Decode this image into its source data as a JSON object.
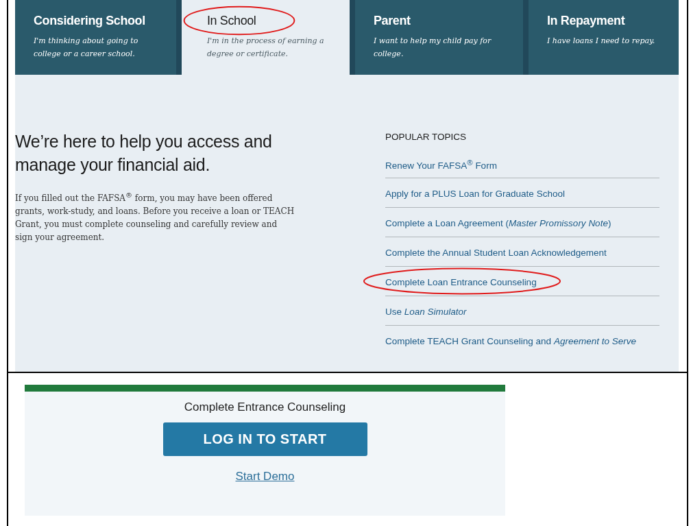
{
  "tabs": [
    {
      "title": "Considering School",
      "subtitle": "I'm thinking about going to college or a career school.",
      "selected": false,
      "circled": false
    },
    {
      "title": "In School",
      "subtitle": "I'm in the process of earning a degree or certificate.",
      "selected": true,
      "circled": true
    },
    {
      "title": "Parent",
      "subtitle": "I want to help my child pay for college.",
      "selected": false,
      "circled": false
    },
    {
      "title": "In Repayment",
      "subtitle": "I have loans I need to repay.",
      "selected": false,
      "circled": false
    }
  ],
  "hero": {
    "heading": "We’re here to help you access and manage your financial aid.",
    "body": "If you filled out the FAFSA$^{®}$ form, you may have been offered grants, work-study, and loans. Before you receive a loan or TEACH Grant, you must complete counseling and carefully review and sign your agreement."
  },
  "popular_topics": {
    "title": "POPULAR TOPICS",
    "items": [
      {
        "label": "Renew Your FAFSA$^{®}$ Form",
        "circled": false
      },
      {
        "label": "Apply for a PLUS Loan for Graduate School",
        "circled": false
      },
      {
        "label": "Complete a Loan Agreement (*Master Promissory Note*)",
        "circled": false
      },
      {
        "label": "Complete the Annual Student Loan Acknowledgement",
        "circled": false
      },
      {
        "label": "Complete Loan Entrance Counseling",
        "circled": true
      },
      {
        "label": "Use *Loan Simulator*",
        "circled": false
      },
      {
        "label": "Complete TEACH Grant Counseling and *Agreement to Serve*",
        "circled": false
      }
    ]
  },
  "counseling_card": {
    "title": "Complete Entrance Counseling",
    "button": "LOG IN TO START",
    "link": "Start Demo"
  }
}
